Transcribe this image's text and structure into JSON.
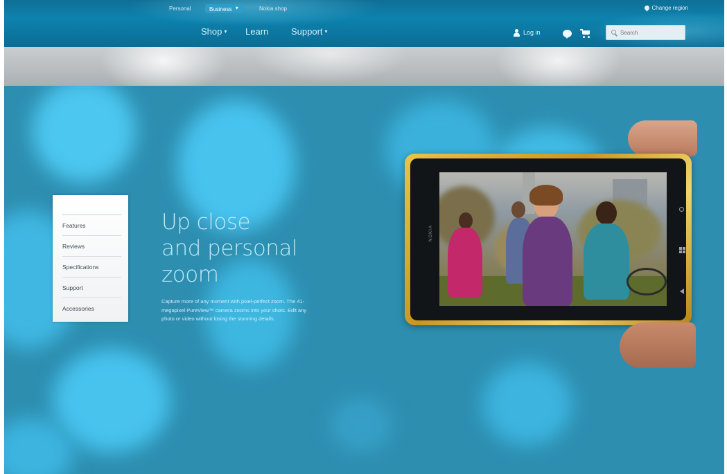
{
  "header": {
    "util_links": [
      "Personal",
      "Business",
      "Nokia shop"
    ],
    "active_util_index": 1,
    "location": "Change region",
    "nav": [
      {
        "label": "Shop",
        "has_caret": true
      },
      {
        "label": "Learn",
        "has_caret": false
      },
      {
        "label": "Support",
        "has_caret": true
      }
    ],
    "login_label": "Log in",
    "search_placeholder": "Search",
    "icons": [
      "user-icon",
      "chat-icon",
      "cart-icon",
      "search-icon",
      "pin-icon"
    ]
  },
  "subnav": {
    "items": [
      "Features",
      "Reviews",
      "Specifications",
      "Support",
      "Accessories"
    ]
  },
  "hero": {
    "headline": [
      "Up close",
      "and personal",
      "zoom"
    ],
    "description": "Capture more of any moment with pixel-perfect zoom. The 41-megapixel PureView™ camera zooms into your shots. Edit any photo or video without losing the stunning details.",
    "phone_brand": "NOKIA"
  },
  "colors": {
    "header_blue": "#0d82ad",
    "hero_blue": "#2d8eb0",
    "highlight_blue": "#46c4ef",
    "phone_gold": "#e9c34a",
    "headline": "#bfe9f7"
  }
}
